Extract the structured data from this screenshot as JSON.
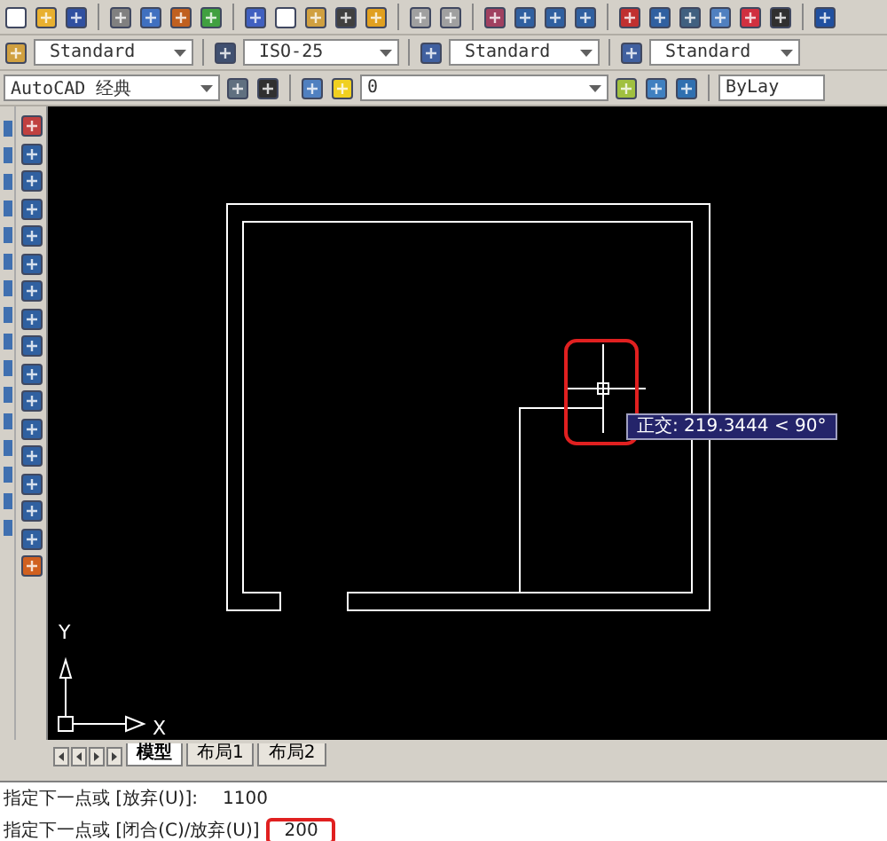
{
  "style_dropdowns": [
    {
      "label": "Standard"
    },
    {
      "label": "ISO-25"
    },
    {
      "label": "Standard"
    },
    {
      "label": "Standard"
    }
  ],
  "workspace": {
    "value": "AutoCAD 经典"
  },
  "layer": {
    "value": "0"
  },
  "color_control": {
    "value": "ByLay"
  },
  "canvas": {
    "tooltip": "正交: 219.3444 < 90°",
    "cursor_highlighted": true,
    "axis_y": "Y",
    "axis_x": "X"
  },
  "layout_tabs": [
    {
      "label": "模型",
      "selected": true
    },
    {
      "label": "布局1",
      "selected": false
    },
    {
      "label": "布局2",
      "selected": false
    }
  ],
  "command_lines": [
    {
      "prompt": "指定下一点或 [放弃(U)]:",
      "value": "1100",
      "highlighted": false
    },
    {
      "prompt": "指定下一点或 [闭合(C)/放弃(U)]",
      "value": "200",
      "highlighted": true
    }
  ]
}
